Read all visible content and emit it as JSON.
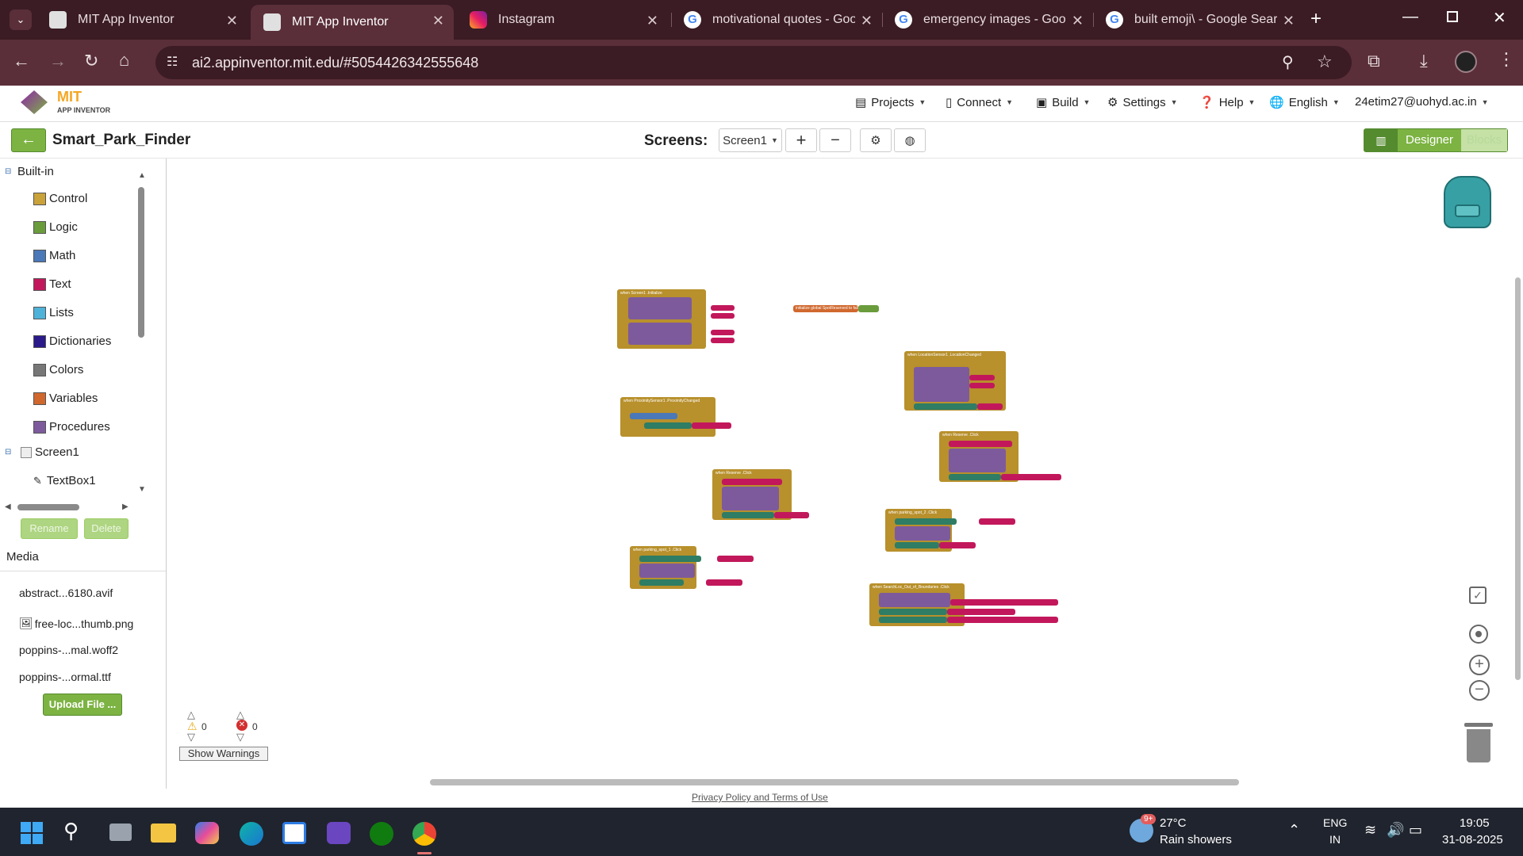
{
  "browser": {
    "tabs": [
      {
        "title": "MIT App Inventor",
        "active": false,
        "favicon": "mit-icon"
      },
      {
        "title": "MIT App Inventor",
        "active": true,
        "favicon": "mit-icon"
      },
      {
        "title": "Instagram",
        "active": false,
        "favicon": "instagram-icon"
      },
      {
        "title": "motivational quotes - Goo",
        "active": false,
        "favicon": "google-icon"
      },
      {
        "title": "emergency images - Goog",
        "active": false,
        "favicon": "google-icon"
      },
      {
        "title": "built emoji\\ - Google Sear",
        "active": false,
        "favicon": "google-icon"
      }
    ],
    "url": "ai2.appinventor.mit.edu/#5054426342555648"
  },
  "app": {
    "logo_title": "MIT",
    "logo_sub": "APP INVENTOR",
    "menu": {
      "projects": "Projects",
      "connect": "Connect",
      "build": "Build",
      "settings": "Settings",
      "help": "Help",
      "language": "English",
      "account": "24etim27@uohyd.ac.in"
    },
    "project_name": "Smart_Park_Finder",
    "screens_label": "Screens:",
    "screen_select": "Screen1",
    "designer_label": "Designer",
    "blocks_label": "Blocks"
  },
  "left_panel": {
    "builtin_label": "Built-in",
    "categories": [
      {
        "label": "Control",
        "color": "#c9a23a"
      },
      {
        "label": "Logic",
        "color": "#6a9c3c"
      },
      {
        "label": "Math",
        "color": "#4a78b8"
      },
      {
        "label": "Text",
        "color": "#c2185b"
      },
      {
        "label": "Lists",
        "color": "#4fb3d9"
      },
      {
        "label": "Dictionaries",
        "color": "#2a1a8a"
      },
      {
        "label": "Colors",
        "color": "#777777"
      },
      {
        "label": "Variables",
        "color": "#d0682e"
      },
      {
        "label": "Procedures",
        "color": "#7d5a9c"
      }
    ],
    "screen_node": "Screen1",
    "component_node": "TextBox1",
    "rename_label": "Rename",
    "delete_label": "Delete",
    "media_title": "Media",
    "media_files": [
      "abstract...6180.avif",
      "free-loc...thumb.png",
      "poppins-...mal.woff2",
      "poppins-...ormal.ttf"
    ],
    "upload_label": "Upload File ..."
  },
  "workspace": {
    "warnings_count": "0",
    "errors_count": "0",
    "show_warnings_label": "Show Warnings",
    "blocks": [
      {
        "header": "when Screen1 .Initialize"
      },
      {
        "header": "initialize global SpotReserved to false"
      },
      {
        "header": "when LocationSensor1 .LocationChanged"
      },
      {
        "header": "when ProximitySensor1 .ProximityChanged"
      },
      {
        "header": "when Reserve .Click"
      },
      {
        "header": "when Reserve .Click"
      },
      {
        "header": "when parking_spot_2 .Click"
      },
      {
        "header": "when parking_spot_1 .Click"
      },
      {
        "header": "when SearchLoc_Out_of_Boundaries .Click"
      }
    ]
  },
  "footer": {
    "privacy": "Privacy Policy and Terms of Use"
  },
  "taskbar": {
    "weather_temp": "27°C",
    "weather_desc": "Rain showers",
    "weather_badge": "9+",
    "lang_top": "ENG",
    "lang_bottom": "IN",
    "time": "19:05",
    "date": "31-08-2025"
  }
}
